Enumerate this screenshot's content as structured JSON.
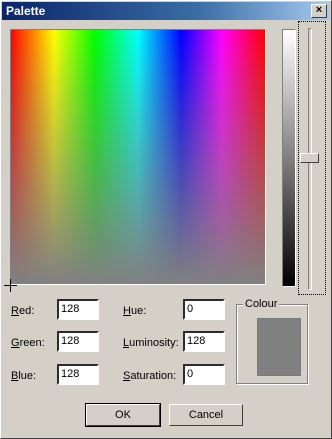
{
  "window": {
    "title": "Palette",
    "close_glyph": "×"
  },
  "fields": {
    "red": {
      "label_ul": "R",
      "label_rest": "ed:",
      "value": "128"
    },
    "green": {
      "label_ul": "G",
      "label_rest": "reen:",
      "value": "128"
    },
    "blue": {
      "label_ul": "B",
      "label_rest": "lue:",
      "value": "128"
    },
    "hue": {
      "label_ul": "H",
      "label_rest": "ue:",
      "value": "0"
    },
    "luminosity": {
      "label_ul": "L",
      "label_rest": "uminosity:",
      "value": "128"
    },
    "saturation": {
      "label_ul": "S",
      "label_rest": "aturation:",
      "value": "0"
    }
  },
  "colour_group": {
    "title": "Colour",
    "swatch_color": "#808080"
  },
  "buttons": {
    "ok": "OK",
    "cancel": "Cancel"
  },
  "icons": {
    "crosshair": "crosshair-icon",
    "close": "close-icon"
  }
}
